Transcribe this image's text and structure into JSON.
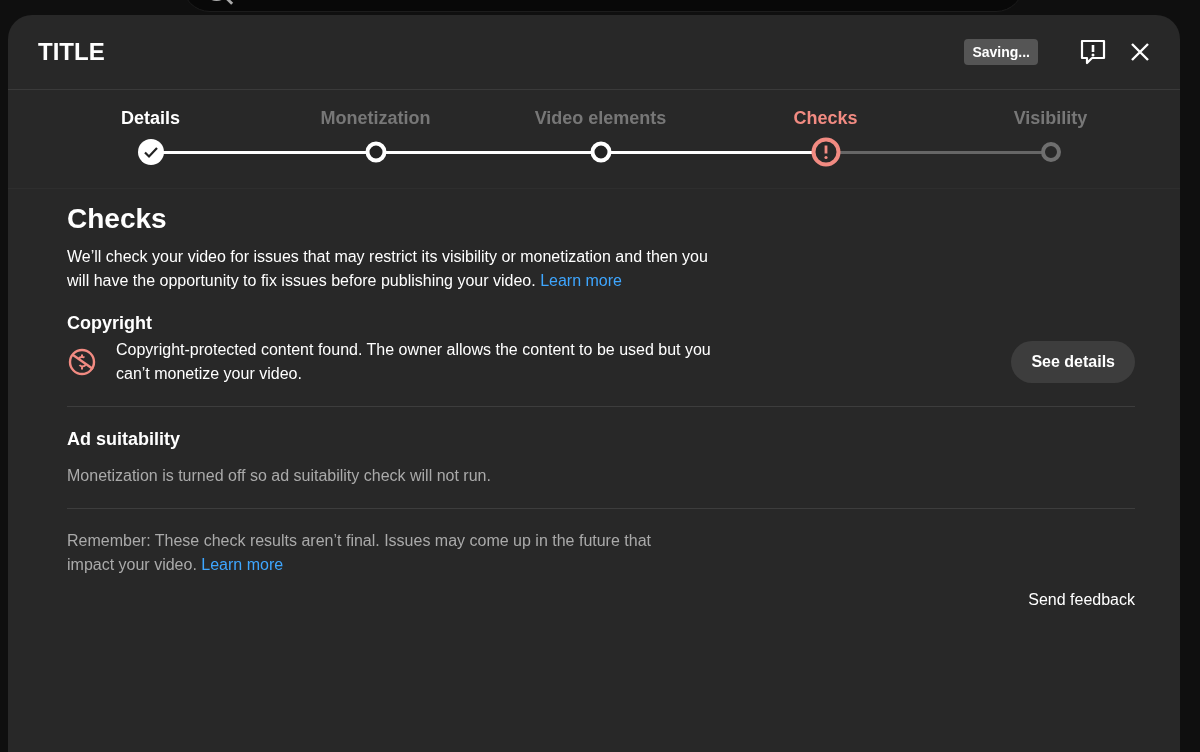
{
  "dialog": {
    "title": "TITLE",
    "saving_badge": "Saving..."
  },
  "steps": [
    {
      "label": "Details",
      "kind": "done"
    },
    {
      "label": "Monetization",
      "kind": "visited"
    },
    {
      "label": "Video elements",
      "kind": "visited"
    },
    {
      "label": "Checks",
      "kind": "error"
    },
    {
      "label": "Visibility",
      "kind": "pending"
    }
  ],
  "checks": {
    "heading": "Checks",
    "intro": "We’ll check your video for issues that may restrict its visibility or monetization and then you will have the opportunity to fix issues before publishing your video.",
    "intro_link": "Learn more",
    "copyright": {
      "heading": "Copyright",
      "message": "Copyright-protected content found. The owner allows the content to be used but you can’t monetize your video.",
      "button": "See details"
    },
    "ad_suitability": {
      "heading": "Ad suitability",
      "message": "Monetization is turned off so ad suitability check will not run."
    },
    "reminder": "Remember: These check results aren’t final. Issues may come up in the future that impact your video.",
    "reminder_link": "Learn more",
    "feedback": "Send feedback"
  }
}
